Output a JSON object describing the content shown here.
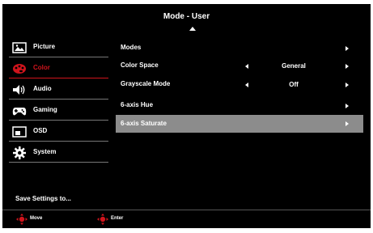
{
  "osd": {
    "title": "Mode - User",
    "sidebar": {
      "items": [
        {
          "label": "Picture",
          "icon": "picture-icon"
        },
        {
          "label": "Color",
          "icon": "color-icon",
          "active": true
        },
        {
          "label": "Audio",
          "icon": "speaker-icon"
        },
        {
          "label": "Gaming",
          "icon": "gamepad-icon"
        },
        {
          "label": "OSD",
          "icon": "osd-icon"
        },
        {
          "label": "System",
          "icon": "gear-icon"
        }
      ],
      "save_label": "Save Settings to..."
    },
    "settings": [
      {
        "label": "Modes"
      },
      {
        "label": "Color Space",
        "value": "General"
      },
      {
        "label": "Grayscale Mode",
        "value": "Off"
      },
      {
        "label": "6-axis Hue"
      },
      {
        "label": "6-axis Saturate",
        "selected": true
      }
    ],
    "footer": {
      "move_label": "Move",
      "enter_label": "Enter"
    },
    "colors": {
      "accent": "#d0141c",
      "selected_row": "#8c8c8c",
      "background": "#000000"
    }
  }
}
